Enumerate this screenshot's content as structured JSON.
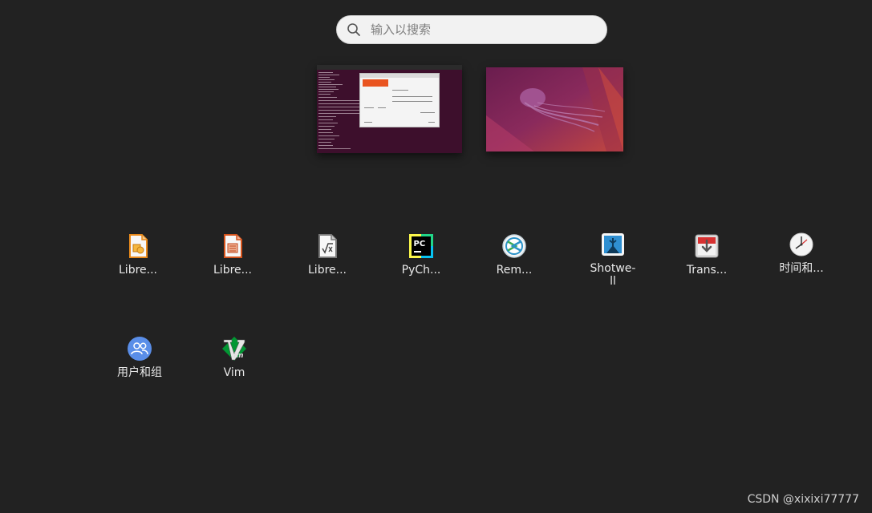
{
  "search": {
    "placeholder": "输入以搜索"
  },
  "workspaces": [
    {
      "name": "workspace-1",
      "content": "terminal-and-dialog"
    },
    {
      "name": "workspace-2",
      "content": "wallpaper"
    }
  ],
  "apps": {
    "row1": [
      {
        "label": "Libre...",
        "icon": "libreoffice-draw-icon"
      },
      {
        "label": "Libre...",
        "icon": "libreoffice-impress-icon"
      },
      {
        "label": "Libre...",
        "icon": "libreoffice-math-icon"
      },
      {
        "label": "PyCh...",
        "icon": "pycharm-icon"
      },
      {
        "label": "Rem...",
        "icon": "remmina-icon"
      },
      {
        "label": "Shotwe-\nll",
        "icon": "shotwell-icon"
      },
      {
        "label": "Trans...",
        "icon": "transmission-icon"
      },
      {
        "label": "时间和...",
        "icon": "clock-icon"
      }
    ],
    "row2": [
      {
        "label": "用户和组",
        "icon": "users-groups-icon"
      },
      {
        "label": "Vim",
        "icon": "vim-icon"
      }
    ]
  },
  "watermark": "CSDN @xixixi77777",
  "colors": {
    "background": "#222222",
    "ubuntu_orange": "#e95420",
    "terminal_purple": "#3d0f2c"
  }
}
